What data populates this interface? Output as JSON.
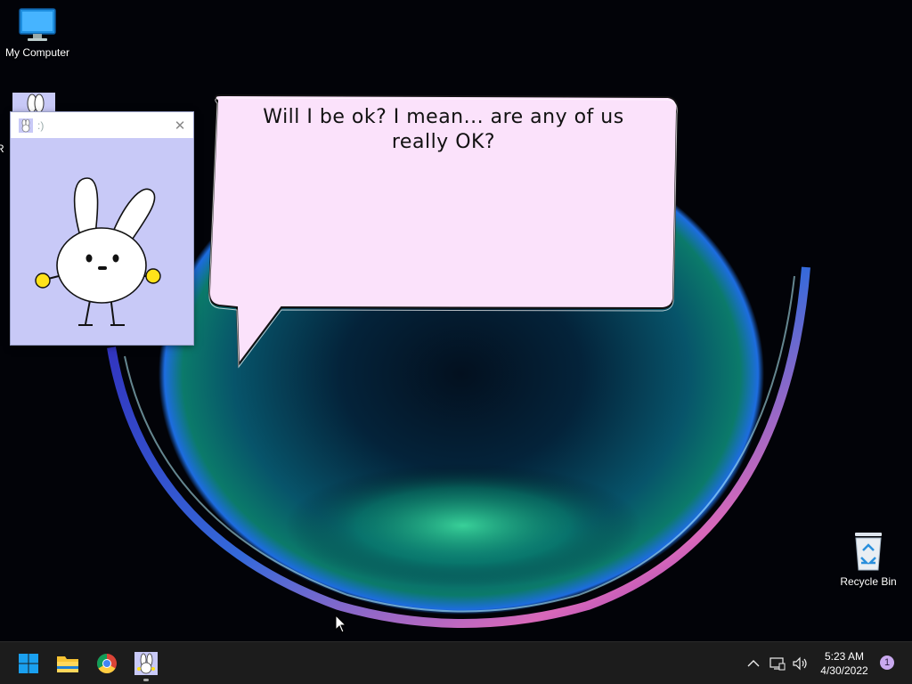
{
  "desktop": {
    "icons": [
      {
        "label": "My Computer",
        "icon": "monitor-icon"
      },
      {
        "label": "R",
        "icon": "bunny-app-icon"
      },
      {
        "label": "Recycle Bin",
        "icon": "recycle-bin-icon"
      }
    ]
  },
  "app_window": {
    "title": ":)",
    "close_glyph": "✕",
    "icon": "bunny-app-icon"
  },
  "speech_bubble": {
    "line1": "Will I be ok? I mean... are any of us",
    "line2": "really OK?"
  },
  "taskbar": {
    "items": [
      {
        "name": "start",
        "icon": "windows-start-icon"
      },
      {
        "name": "file-explorer",
        "icon": "folder-icon"
      },
      {
        "name": "chrome",
        "icon": "chrome-icon"
      },
      {
        "name": "bunny-app",
        "icon": "bunny-app-icon"
      }
    ],
    "tray": {
      "chevron_glyph": "^",
      "time": "5:23 AM",
      "date": "4/30/2022",
      "notification_count": "1"
    }
  },
  "colors": {
    "bubble_fill": "#fbe2fb",
    "window_bg": "#c8c9f7",
    "taskbar_bg": "#1c1c1c",
    "bunny_hands": "#ffe21a"
  }
}
